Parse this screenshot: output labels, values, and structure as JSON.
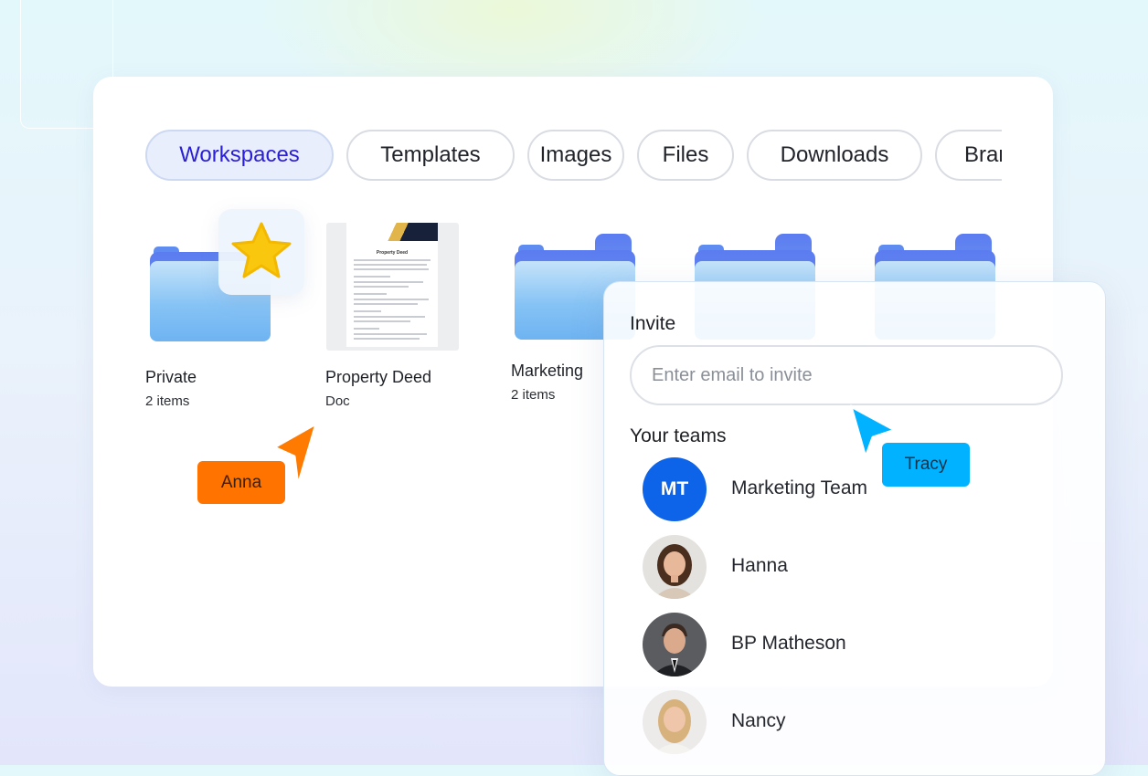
{
  "tabs": [
    {
      "label": "Workspaces",
      "active": true
    },
    {
      "label": "Templates"
    },
    {
      "label": "Images"
    },
    {
      "label": "Files"
    },
    {
      "label": "Downloads"
    },
    {
      "label": "Brar"
    }
  ],
  "items": [
    {
      "name": "Private",
      "meta": "2 items",
      "icon": "folder-icon",
      "badge": "star-icon"
    },
    {
      "name": "Property Deed",
      "meta": "Doc",
      "icon": "document-thumbnail"
    },
    {
      "name": "Marketing",
      "meta": "2 items",
      "icon": "folder-icon"
    }
  ],
  "doc_preview": {
    "title": "Property Deed"
  },
  "collaborators": [
    {
      "name": "Anna",
      "color": "#ff7300",
      "text_color": "#3a2010"
    },
    {
      "name": "Tracy",
      "color": "#00b2ff",
      "text_color": "#12344a"
    }
  ],
  "invite": {
    "title": "Invite",
    "placeholder": "Enter email to invite",
    "teams_title": "Your teams",
    "members": [
      {
        "name": "Marketing Team",
        "initials": "MT",
        "avatar": "initials",
        "color": "#0d64e8"
      },
      {
        "name": "Hanna",
        "avatar": "photo-woman-brown-hair"
      },
      {
        "name": "BP Matheson",
        "avatar": "photo-man-suit"
      },
      {
        "name": "Nancy",
        "avatar": "photo-woman-blonde"
      }
    ]
  },
  "colors": {
    "accent": "#2a1fd6",
    "folder_blue": "#6eb3f2",
    "star": "#f9c80e"
  }
}
